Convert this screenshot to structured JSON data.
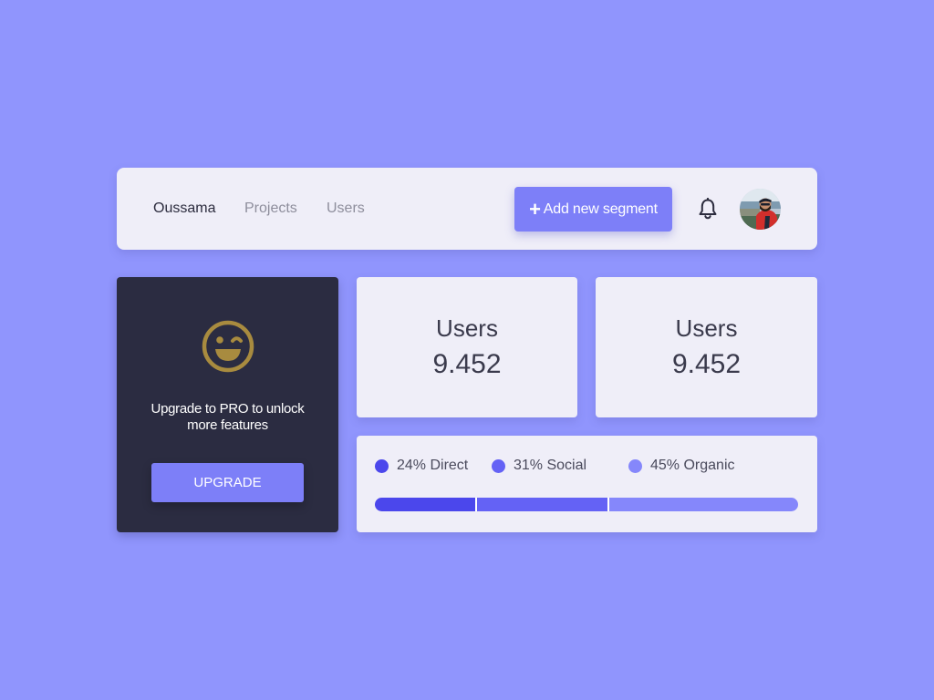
{
  "nav": {
    "links": [
      {
        "label": "Oussama",
        "active": true
      },
      {
        "label": "Projects",
        "active": false
      },
      {
        "label": "Users",
        "active": false
      }
    ],
    "add_button_label": "Add new segment",
    "bell_icon": "bell-icon",
    "avatar_icon": "user-avatar"
  },
  "promo": {
    "icon": "wink-smile-icon",
    "text": "Upgrade to PRO to unlock more features",
    "button_label": "UPGRADE"
  },
  "stats": [
    {
      "label": "Users",
      "value": "9.452"
    },
    {
      "label": "Users",
      "value": "9.452"
    }
  ],
  "segments": [
    {
      "label": "24% Direct",
      "percent": 24,
      "color": "#4b47ec"
    },
    {
      "label": "31% Social",
      "percent": 31,
      "color": "#6462f5"
    },
    {
      "label": "45% Organic",
      "percent": 45,
      "color": "#8587fb"
    }
  ],
  "colors": {
    "background": "#9095fd",
    "accent": "#7d7ff8",
    "dark_card": "#2b2c41",
    "smile_gold": "#a88b3f"
  }
}
